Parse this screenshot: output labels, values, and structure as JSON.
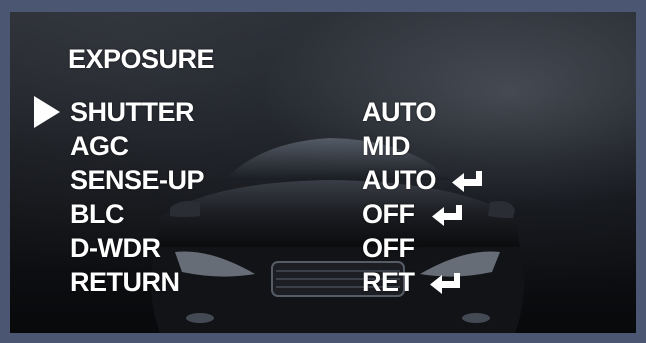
{
  "menu": {
    "title": "EXPOSURE",
    "selected_index": 0,
    "items": [
      {
        "label": "SHUTTER",
        "value": "AUTO",
        "has_enter": false
      },
      {
        "label": "AGC",
        "value": "MID",
        "has_enter": false
      },
      {
        "label": "SENSE-UP",
        "value": "AUTO",
        "has_enter": true
      },
      {
        "label": "BLC",
        "value": "OFF",
        "has_enter": true
      },
      {
        "label": "D-WDR",
        "value": "OFF",
        "has_enter": false
      },
      {
        "label": "RETURN",
        "value": "RET",
        "has_enter": true
      }
    ]
  },
  "icons": {
    "cursor": "triangle-right-icon",
    "enter": "enter-return-icon"
  },
  "colors": {
    "frame": "#4b5672",
    "text": "#ffffff"
  }
}
